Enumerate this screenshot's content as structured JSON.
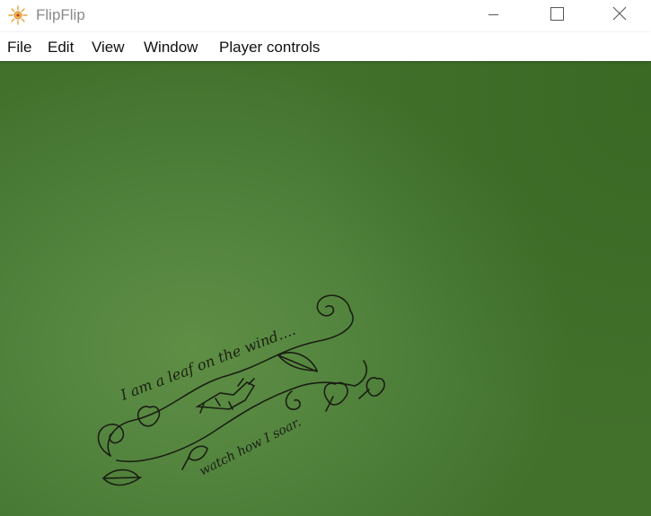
{
  "window": {
    "title": "FlipFlip",
    "buttons": {
      "minimize": "minimize-icon",
      "maximize": "maximize-icon",
      "close": "close-icon"
    }
  },
  "menu": {
    "file": "File",
    "edit": "Edit",
    "view": "View",
    "window": "Window",
    "player_controls": "Player controls"
  },
  "player": {
    "background_color": "#558640",
    "image": {
      "line1": "I am a leaf on the wind....",
      "line2": "watch how I soar."
    }
  }
}
